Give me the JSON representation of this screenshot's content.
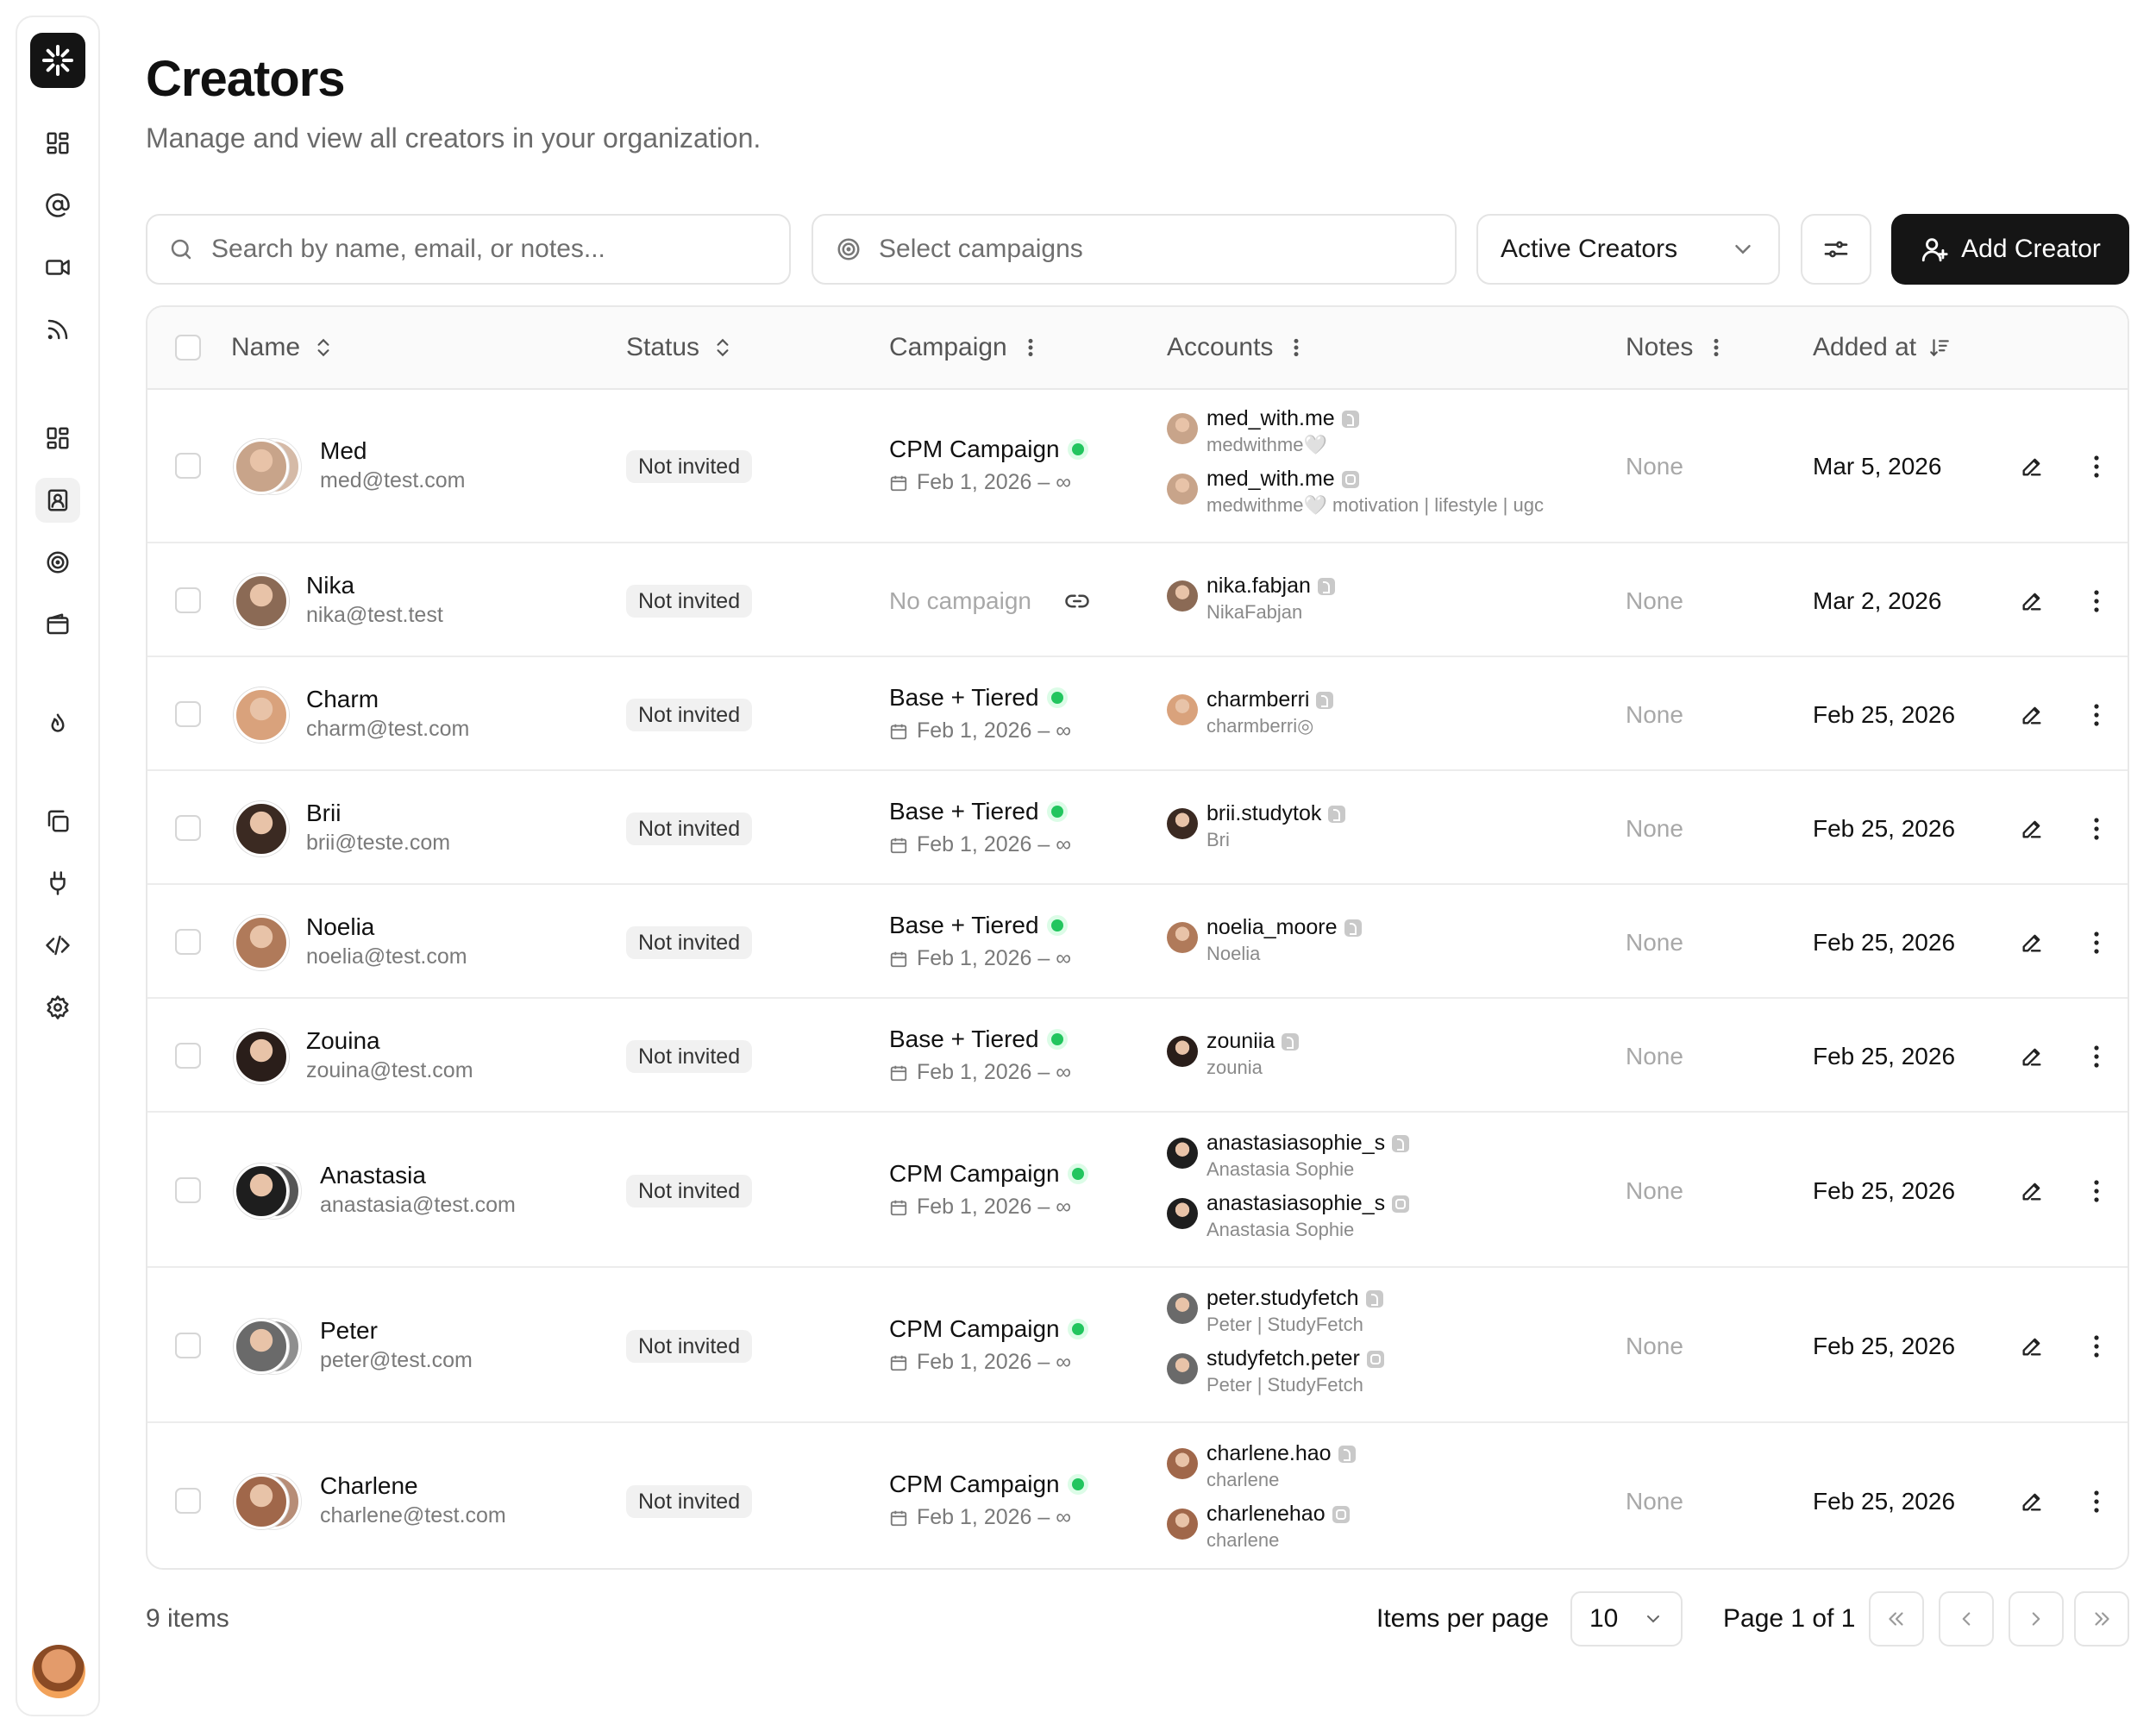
{
  "header": {
    "title": "Creators",
    "subtitle": "Manage and view all creators in your organization."
  },
  "toolbar": {
    "search_placeholder": "Search by name, email, or notes...",
    "campaigns_placeholder": "Select campaigns",
    "status_filter": "Active Creators",
    "add_label": "Add Creator"
  },
  "table": {
    "columns": [
      "Name",
      "Status",
      "Campaign",
      "Accounts",
      "Notes",
      "Added at"
    ],
    "rows": [
      {
        "name": "Med",
        "email": "med@test.com",
        "status": "Not invited",
        "campaign": "CPM Campaign",
        "campaign_dates": "Feb 1, 2026 – ∞",
        "accounts": [
          {
            "handle": "med_with.me",
            "platform": "tiktok",
            "sub": "medwithme🤍"
          },
          {
            "handle": "med_with.me",
            "platform": "instagram",
            "sub": "medwithme🤍 motivation | lifestyle | ugc"
          }
        ],
        "notes": "None",
        "added": "Mar 5, 2026"
      },
      {
        "name": "Nika",
        "email": "nika@test.test",
        "status": "Not invited",
        "campaign": "",
        "no_campaign": "No campaign",
        "campaign_dates": "",
        "accounts": [
          {
            "handle": "nika.fabjan",
            "platform": "tiktok",
            "sub": "NikaFabjan"
          }
        ],
        "notes": "None",
        "added": "Mar 2, 2026"
      },
      {
        "name": "Charm",
        "email": "charm@test.com",
        "status": "Not invited",
        "campaign": "Base + Tiered",
        "campaign_dates": "Feb 1, 2026 – ∞",
        "accounts": [
          {
            "handle": "charmberri",
            "platform": "tiktok",
            "sub": "charmberri◎"
          }
        ],
        "notes": "None",
        "added": "Feb 25, 2026"
      },
      {
        "name": "Brii",
        "email": "brii@teste.com",
        "status": "Not invited",
        "campaign": "Base + Tiered",
        "campaign_dates": "Feb 1, 2026 – ∞",
        "accounts": [
          {
            "handle": "brii.studytok",
            "platform": "tiktok",
            "sub": "Bri"
          }
        ],
        "notes": "None",
        "added": "Feb 25, 2026"
      },
      {
        "name": "Noelia",
        "email": "noelia@test.com",
        "status": "Not invited",
        "campaign": "Base + Tiered",
        "campaign_dates": "Feb 1, 2026 – ∞",
        "accounts": [
          {
            "handle": "noelia_moore",
            "platform": "tiktok",
            "sub": "Noelia"
          }
        ],
        "notes": "None",
        "added": "Feb 25, 2026"
      },
      {
        "name": "Zouina",
        "email": "zouina@test.com",
        "status": "Not invited",
        "campaign": "Base + Tiered",
        "campaign_dates": "Feb 1, 2026 – ∞",
        "accounts": [
          {
            "handle": "zouniia",
            "platform": "tiktok",
            "sub": "zounia"
          }
        ],
        "notes": "None",
        "added": "Feb 25, 2026"
      },
      {
        "name": "Anastasia",
        "email": "anastasia@test.com",
        "status": "Not invited",
        "campaign": "CPM Campaign",
        "campaign_dates": "Feb 1, 2026 – ∞",
        "accounts": [
          {
            "handle": "anastasiasophie_s",
            "platform": "tiktok",
            "sub": "Anastasia Sophie"
          },
          {
            "handle": "anastasiasophie_s",
            "platform": "instagram",
            "sub": "Anastasia Sophie"
          }
        ],
        "notes": "None",
        "added": "Feb 25, 2026"
      },
      {
        "name": "Peter",
        "email": "peter@test.com",
        "status": "Not invited",
        "campaign": "CPM Campaign",
        "campaign_dates": "Feb 1, 2026 – ∞",
        "accounts": [
          {
            "handle": "peter.studyfetch",
            "platform": "tiktok",
            "sub": "Peter | StudyFetch"
          },
          {
            "handle": "studyfetch.peter",
            "platform": "instagram",
            "sub": "Peter | StudyFetch"
          }
        ],
        "notes": "None",
        "added": "Feb 25, 2026"
      },
      {
        "name": "Charlene",
        "email": "charlene@test.com",
        "status": "Not invited",
        "campaign": "CPM Campaign",
        "campaign_dates": "Feb 1, 2026 – ∞",
        "accounts": [
          {
            "handle": "charlene.hao",
            "platform": "tiktok",
            "sub": "charlene"
          },
          {
            "handle": "charlenehao",
            "platform": "instagram",
            "sub": "charlene"
          }
        ],
        "notes": "None",
        "added": "Feb 25, 2026"
      }
    ]
  },
  "footer": {
    "items_count": "9 items",
    "items_per_page_label": "Items per page",
    "items_per_page": "10",
    "page_info": "Page 1 of 1"
  },
  "colors": {
    "primary": "#151515",
    "active_dot": "#22c55e",
    "badge_bg": "#f1f1f1"
  }
}
